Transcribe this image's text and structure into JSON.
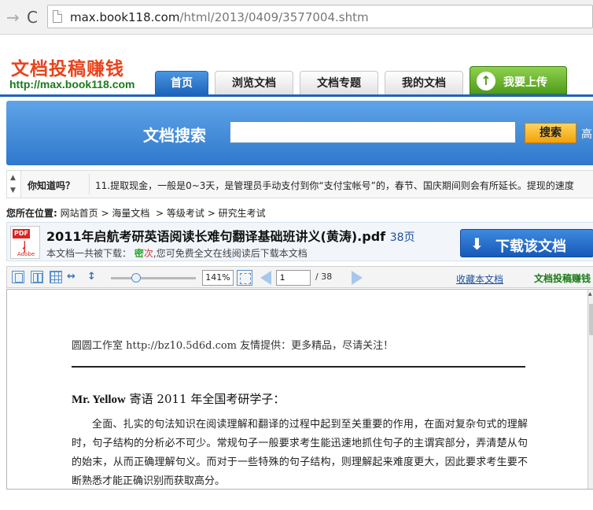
{
  "browser": {
    "url_host": "max.book118.com",
    "url_path": "/html/2013/0409/3577004.shtm"
  },
  "header": {
    "logo_text": "文档投稿赚钱",
    "logo_url": "http://max.book118.com",
    "tabs": [
      {
        "label": "首页"
      },
      {
        "label": "浏览文档"
      },
      {
        "label": "文档专题"
      },
      {
        "label": "我的文档"
      }
    ],
    "upload_label": "我要上传"
  },
  "search": {
    "title": "文档搜索",
    "button_label": "搜索",
    "advanced_label": "高"
  },
  "tips": {
    "label": "你知道吗？",
    "text": "11.提取现金，一般是0~3天，是管理员手动支付到你“支付宝帐号”的，春节、国庆期间则会有所延长。提现的速度"
  },
  "breadcrumb": {
    "label": "您所在位置:",
    "items": [
      "网站首页",
      "海量文档",
      "等级考试",
      "研究生考试"
    ]
  },
  "document": {
    "title": "2011年启航考研英语阅读长难句翻译基础班讲义(黄涛).pdf",
    "pages_text": "38页",
    "meta_prefix": "本文档一共被下载：",
    "download_count": "密",
    "download_unit": "次",
    "meta_suffix": ",您可免费全文在线阅读后下载本文档",
    "download_label": "下载该文档",
    "pdf_icon_label": "PDF",
    "pdf_icon_brand": "Adobe"
  },
  "viewer": {
    "zoom": "141%",
    "zoom_fraction": 0.3,
    "current_page": "1",
    "total_pages": "/ 38",
    "favorite_label": "收藏本文档",
    "brand_label": "文档投稿赚钱"
  },
  "page_content": {
    "header": "圆圆工作室 http://bz10.5d6d.com 友情提供：更多精品，尽请关注！",
    "greeting_name": "Mr. Yellow",
    "greeting_rest": " 寄语 2011 年全国考研学子：",
    "body": "全面、扎实的句法知识在阅读理解和翻译的过程中起到至关重要的作用，在面对复杂句式的理解时，句子结构的分析必不可少。常规句子一般要求考生能迅速地抓住句子的主谓宾部分，弄清楚从句的始末，从而正确理解句义。而对于一些特殊的句子结构，则理解起来难度更大，因此要求考生要不断熟悉才能正确识别而获取高分。"
  },
  "colors": {
    "brand_blue": "#1d64bc",
    "logo_red": "#e8431c",
    "upload_green": "#4e9c1a",
    "search_orange": "#f1a20a"
  }
}
